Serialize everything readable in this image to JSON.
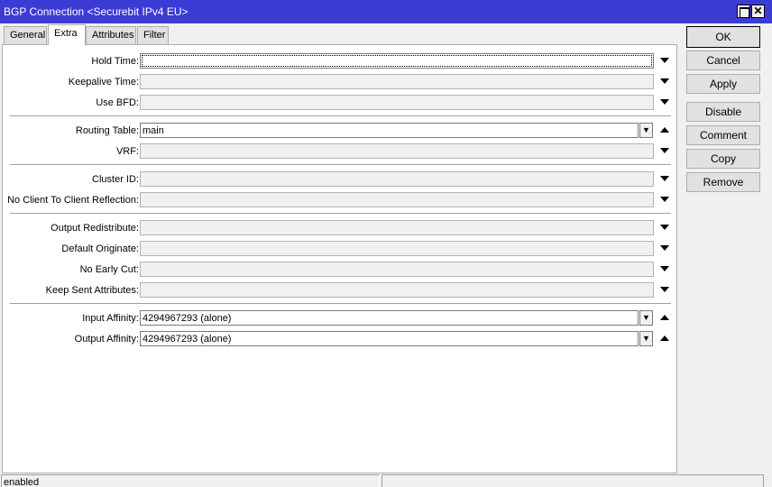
{
  "window": {
    "title": "BGP Connection <Securebit IPv4 EU>",
    "maximize_icon": "maximize-icon",
    "close_icon": "close-icon",
    "title_color": "#3b3bd6"
  },
  "tabs": [
    "General",
    "Extra",
    "Attributes",
    "Filter"
  ],
  "active_tab": "Extra",
  "fields": {
    "hold_time": {
      "label": "Hold Time:",
      "value": ""
    },
    "keepalive_time": {
      "label": "Keepalive Time:",
      "value": ""
    },
    "use_bfd": {
      "label": "Use BFD:",
      "value": ""
    },
    "routing_table": {
      "label": "Routing Table:",
      "value": "main"
    },
    "vrf": {
      "label": "VRF:",
      "value": ""
    },
    "cluster_id": {
      "label": "Cluster ID:",
      "value": ""
    },
    "no_client_reflection": {
      "label": "No Client To Client Reflection:",
      "value": ""
    },
    "output_redistribute": {
      "label": "Output Redistribute:",
      "value": ""
    },
    "default_originate": {
      "label": "Default Originate:",
      "value": ""
    },
    "no_early_cut": {
      "label": "No Early Cut:",
      "value": ""
    },
    "keep_sent_attributes": {
      "label": "Keep Sent Attributes:",
      "value": ""
    },
    "input_affinity": {
      "label": "Input Affinity:",
      "value": "4294967293 (alone)"
    },
    "output_affinity": {
      "label": "Output Affinity:",
      "value": "4294967293 (alone)"
    }
  },
  "buttons": {
    "ok": "OK",
    "cancel": "Cancel",
    "apply": "Apply",
    "disable": "Disable",
    "comment": "Comment",
    "copy": "Copy",
    "remove": "Remove"
  },
  "status": {
    "left": "enabled",
    "right": ""
  }
}
